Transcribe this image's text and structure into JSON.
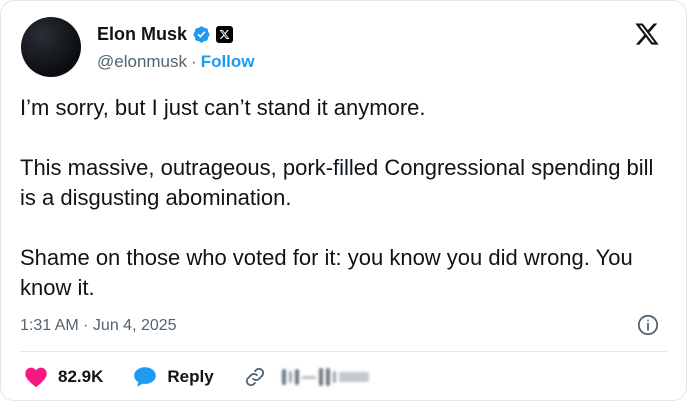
{
  "author": {
    "name": "Elon Musk",
    "handle": "@elonmusk",
    "separator": "·",
    "follow_label": "Follow",
    "verified_color": "#1d9bf0"
  },
  "tweet": {
    "paragraphs": [
      "I’m sorry, but I just can’t stand it anymore.",
      "This massive, outrageous, pork-filled Congressional spending bill is a disgusting abomination.",
      "Shame on those who voted for it: you know you did wrong. You know it."
    ],
    "timestamp": "1:31 AM · Jun 4, 2025"
  },
  "actions": {
    "like_count": "82.9K",
    "reply_label": "Reply",
    "like_color": "#f91880",
    "reply_color": "#1d9bf0"
  },
  "icons": {
    "verified": "verified-badge-icon",
    "x_badge": "x-logo-icon",
    "brand": "x-logo-icon",
    "info": "info-icon",
    "heart": "heart-icon",
    "reply": "speech-bubble-icon",
    "link": "link-icon"
  }
}
